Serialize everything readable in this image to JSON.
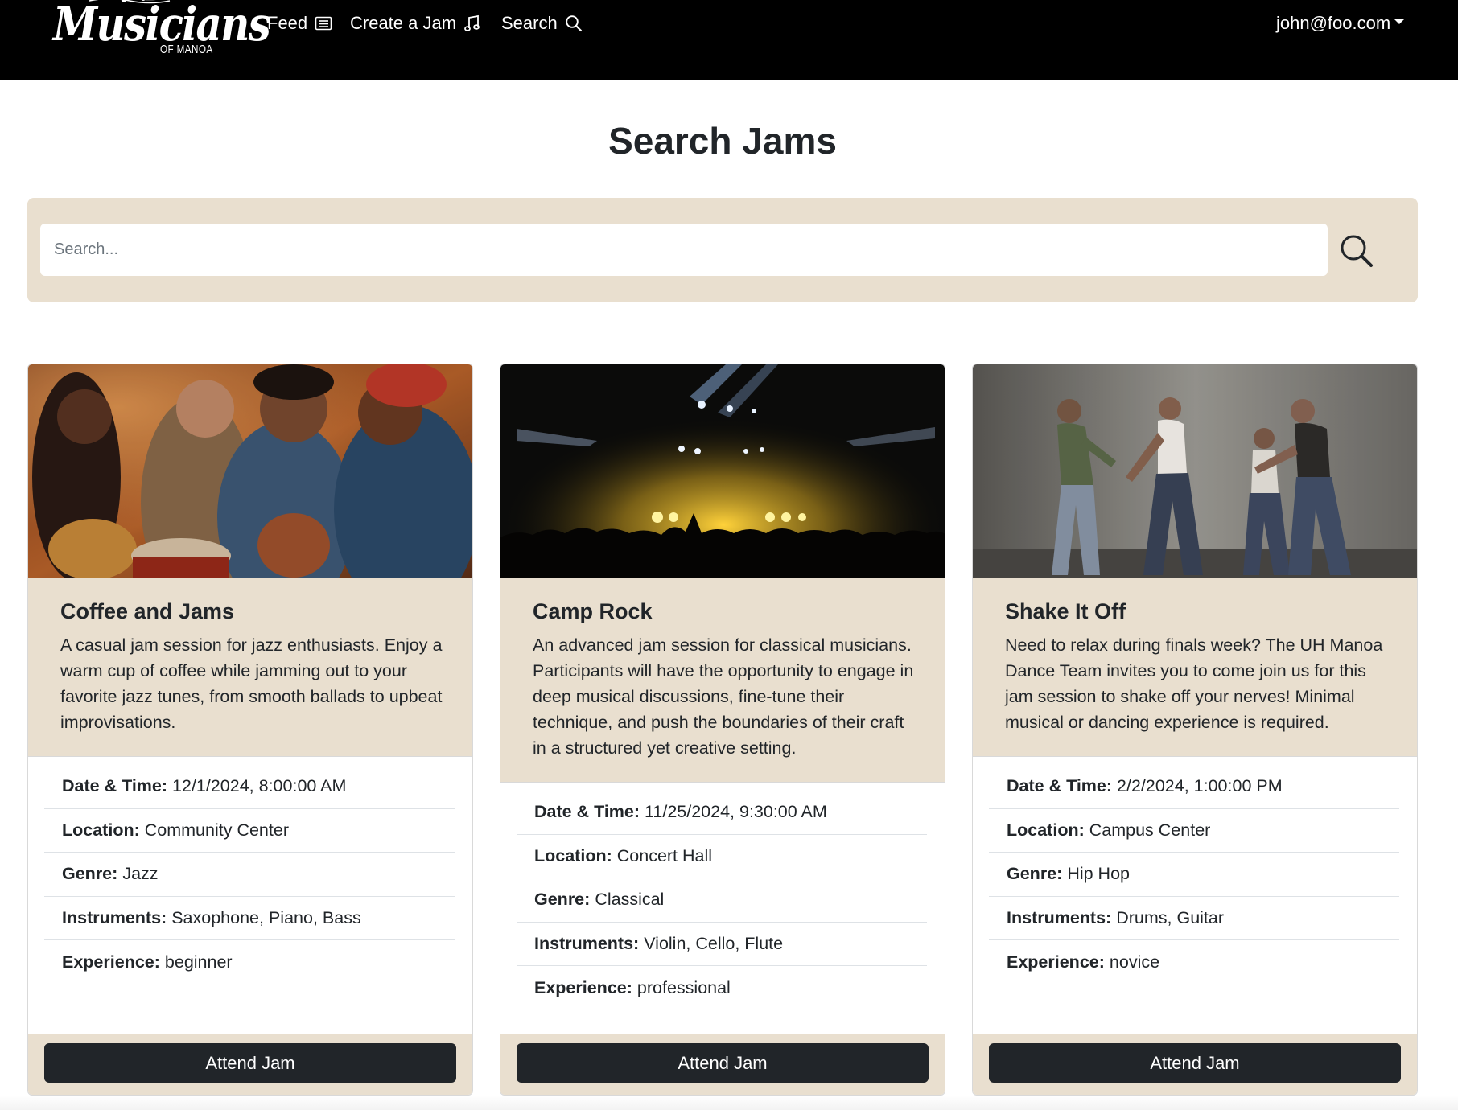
{
  "brand": {
    "name": "Musicians",
    "subtitle": "OF MANOA"
  },
  "nav": {
    "feed": "Feed",
    "create": "Create a Jam",
    "search": "Search",
    "user": "john@foo.com"
  },
  "page": {
    "title": "Search Jams"
  },
  "search": {
    "placeholder": "Search...",
    "value": ""
  },
  "cards": [
    {
      "title": "Coffee and Jams",
      "description": "A casual jam session for jazz enthusiasts. Enjoy a warm cup of coffee while jamming out to your favorite jazz tunes, from smooth ballads to upbeat improvisations.",
      "details": [
        {
          "label": "Date & Time:",
          "value": "12/1/2024, 8:00:00 AM"
        },
        {
          "label": "Location:",
          "value": "Community Center"
        },
        {
          "label": "Genre:",
          "value": "Jazz"
        },
        {
          "label": "Instruments:",
          "value": "Saxophone, Piano, Bass"
        },
        {
          "label": "Experience:",
          "value": "beginner"
        }
      ],
      "button": "Attend Jam"
    },
    {
      "title": "Camp Rock",
      "description": "An advanced jam session for classical musicians. Participants will have the opportunity to engage in deep musical discussions, fine-tune their technique, and push the boundaries of their craft in a structured yet creative setting.",
      "details": [
        {
          "label": "Date & Time:",
          "value": "11/25/2024, 9:30:00 AM"
        },
        {
          "label": "Location:",
          "value": "Concert Hall"
        },
        {
          "label": "Genre:",
          "value": "Classical"
        },
        {
          "label": "Instruments:",
          "value": "Violin, Cello, Flute"
        },
        {
          "label": "Experience:",
          "value": "professional"
        }
      ],
      "button": "Attend Jam"
    },
    {
      "title": "Shake It Off",
      "description": "Need to relax during finals week? The UH Manoa Dance Team invites you to come join us for this jam session to shake off your nerves! Minimal musical or dancing experience is required.",
      "details": [
        {
          "label": "Date & Time:",
          "value": "2/2/2024, 1:00:00 PM"
        },
        {
          "label": "Location:",
          "value": "Campus Center"
        },
        {
          "label": "Genre:",
          "value": "Hip Hop"
        },
        {
          "label": "Instruments:",
          "value": "Drums, Guitar"
        },
        {
          "label": "Experience:",
          "value": "novice"
        }
      ],
      "button": "Attend Jam"
    }
  ],
  "icons": {
    "feed": "newspaper-icon",
    "create": "music-note-icon",
    "search": "search-icon",
    "user": "caret-down-icon"
  },
  "colors": {
    "navbar": "#000000",
    "panel": "#e9dfcf",
    "button": "#212529"
  }
}
